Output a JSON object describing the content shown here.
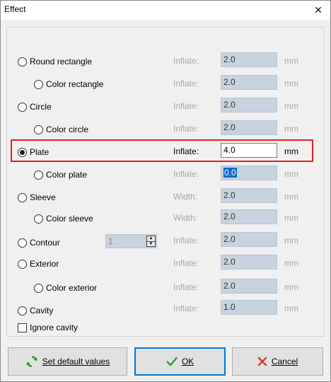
{
  "window": {
    "title": "Effect",
    "close_glyph": "✕"
  },
  "options": [
    {
      "key": "round_rectangle",
      "label": "Round rectangle",
      "param_label": "Inflate:",
      "value": "2.0",
      "unit": "mm",
      "checked": false,
      "enabled": false
    },
    {
      "key": "color_rectangle",
      "label": "Color rectangle",
      "param_label": "Inflate:",
      "value": "2.0",
      "unit": "mm",
      "checked": false,
      "enabled": false
    },
    {
      "key": "circle",
      "label": "Circle",
      "param_label": "Inflate:",
      "value": "2.0",
      "unit": "mm",
      "checked": false,
      "enabled": false
    },
    {
      "key": "color_circle",
      "label": "Color circle",
      "param_label": "Inflate:",
      "value": "2.0",
      "unit": "mm",
      "checked": false,
      "enabled": false
    },
    {
      "key": "plate",
      "label": "Plate",
      "param_label": "Inflate:",
      "value": "4.0",
      "unit": "mm",
      "checked": true,
      "enabled": true
    },
    {
      "key": "color_plate",
      "label": "Color plate",
      "param_label": "Inflate:",
      "value": "0.0",
      "unit": "mm",
      "checked": false,
      "enabled": false
    },
    {
      "key": "sleeve",
      "label": "Sleeve",
      "param_label": "Width:",
      "value": "2.0",
      "unit": "mm",
      "checked": false,
      "enabled": false
    },
    {
      "key": "color_sleeve",
      "label": "Color sleeve",
      "param_label": "Width:",
      "value": "2.0",
      "unit": "mm",
      "checked": false,
      "enabled": false
    },
    {
      "key": "contour",
      "label": "Contour",
      "param_label": "Inflate:",
      "value": "2.0",
      "unit": "mm",
      "checked": false,
      "enabled": false
    },
    {
      "key": "exterior",
      "label": "Exterior",
      "param_label": "Inflate:",
      "value": "2.0",
      "unit": "mm",
      "checked": false,
      "enabled": false
    },
    {
      "key": "color_exterior",
      "label": "Color exterior",
      "param_label": "Inflate:",
      "value": "2.0",
      "unit": "mm",
      "checked": false,
      "enabled": false
    },
    {
      "key": "cavity",
      "label": "Cavity",
      "param_label": "Inflate:",
      "value": "1.0",
      "unit": "mm",
      "checked": false,
      "enabled": false
    }
  ],
  "contour_spin": {
    "value": "1"
  },
  "ignore_cavity": {
    "label": "Ignore cavity",
    "checked": false
  },
  "buttons": {
    "defaults": {
      "label": "Set default values",
      "icon": "refresh-icon"
    },
    "ok": {
      "label": "OK",
      "icon": "checkmark-icon"
    },
    "cancel": {
      "label": "Cancel",
      "icon": "x-icon"
    }
  },
  "colors": {
    "highlight": "#e02020",
    "disabled_field": "#c7d3de",
    "selection": "#0a6ad0"
  }
}
